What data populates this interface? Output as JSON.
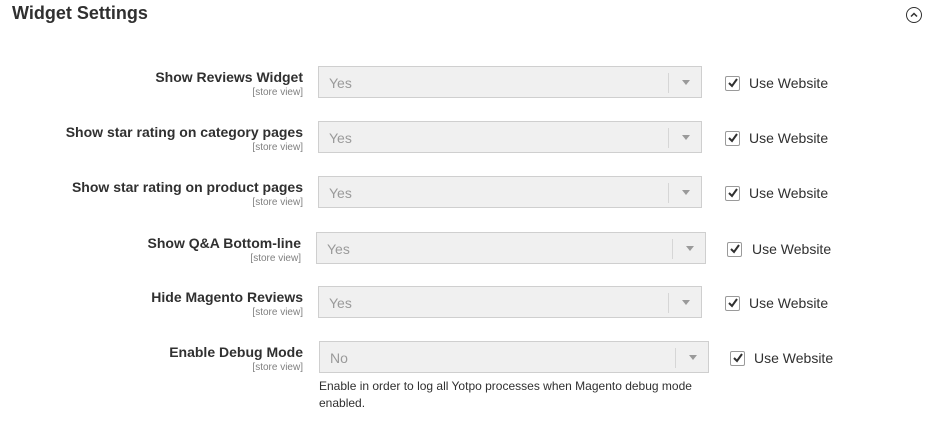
{
  "section": {
    "title": "Widget Settings"
  },
  "rows": [
    {
      "label": "Show Reviews Widget",
      "scope": "[store view]",
      "value": "Yes",
      "use_website": "Use Website",
      "checked": true
    },
    {
      "label": "Show star rating on category pages",
      "scope": "[store view]",
      "value": "Yes",
      "use_website": "Use Website",
      "checked": true
    },
    {
      "label": "Show star rating on product pages",
      "scope": "[store view]",
      "value": "Yes",
      "use_website": "Use Website",
      "checked": true
    },
    {
      "label": "Show Q&A Bottom-line",
      "scope": "[store view]",
      "value": "Yes",
      "use_website": "Use Website",
      "checked": true
    },
    {
      "label": "Hide Magento Reviews",
      "scope": "[store view]",
      "value": "Yes",
      "use_website": "Use Website",
      "checked": true
    },
    {
      "label": "Enable Debug Mode",
      "scope": "[store view]",
      "value": "No",
      "use_website": "Use Website",
      "checked": true
    }
  ],
  "debug_note": "Enable in order to log all Yotpo processes when Magento debug mode enabled.",
  "icons": {
    "collapse": "chevron-up-circle-icon",
    "checkbox": "checkmark-icon",
    "dropdown": "chevron-down-icon"
  }
}
